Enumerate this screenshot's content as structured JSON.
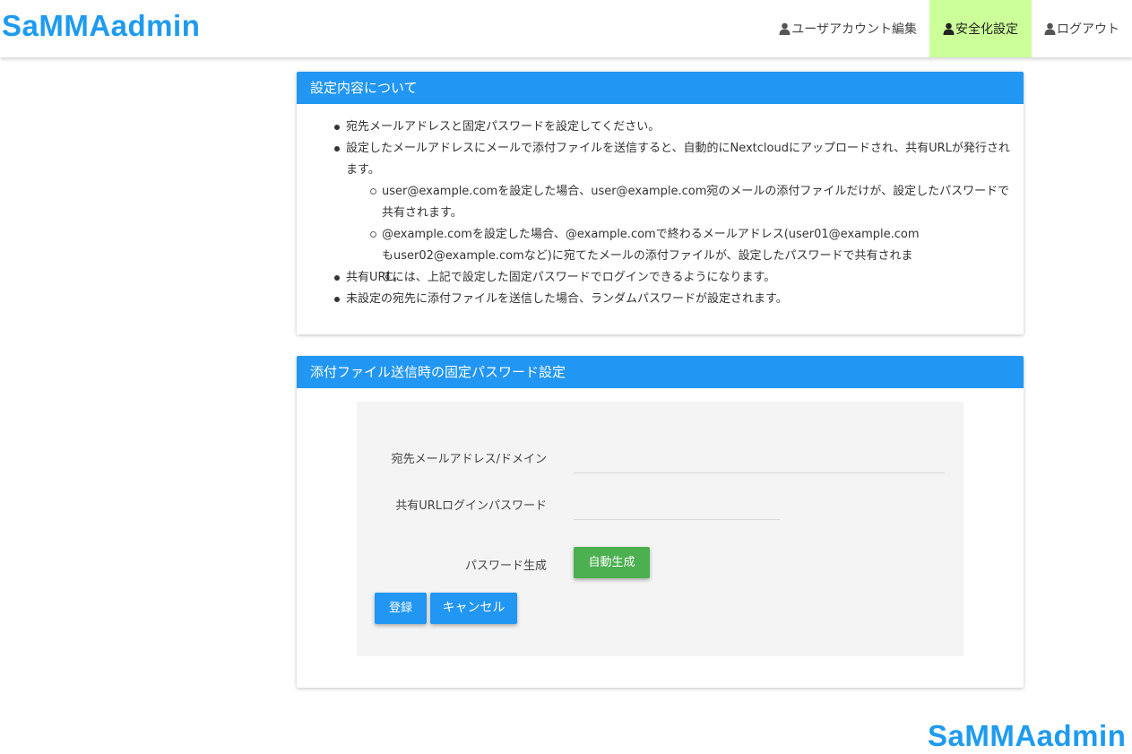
{
  "header": {
    "brand": "SaMMAadmin",
    "nav": [
      {
        "label": "ユーザアカウント編集",
        "icon": "user-icon"
      },
      {
        "label": "安全化設定",
        "icon": "user-icon",
        "active": true
      },
      {
        "label": "ログアウト",
        "icon": "user-icon"
      }
    ]
  },
  "info_card": {
    "title": "設定内容について",
    "items": [
      "宛先メールアドレスと固定パスワードを設定してください。",
      "設定したメールアドレスにメールで添付ファイルを送信すると、自動的にNextcloudにアップロードされ、共有URLが発行されます。",
      "user@example.comを設定した場合、user@example.com宛のメールの添付ファイルだけが、設定したパスワードで共有されます。",
      "@example.comを設定した場合、@example.comで終わるメールアドレス(user01@example.comもuser02@example.comなど)に宛てたメールの添付ファイルが、設定したパスワードで共有されます。",
      "共有URLには、上記で設定した固定パスワードでログインできるようになります。",
      "未設定の宛先に添付ファイルを送信した場合、ランダムパスワードが設定されます。"
    ]
  },
  "form_card": {
    "title": "添付ファイル送信時の固定パスワード設定",
    "address_label": "宛先メールアドレス/ドメイン",
    "address_value": "",
    "password_label": "共有URLログインパスワード",
    "password_value": "",
    "generate_label": "パスワード生成",
    "generate_button": "自動生成",
    "submit_button": "登録",
    "cancel_button": "キャンセル"
  },
  "footer": {
    "brand": "SaMMAadmin"
  },
  "colors": {
    "brand": "#1e9bf0",
    "header_bar": "#2196f3",
    "active_nav": "#ccff99",
    "green_button": "#4caf50"
  }
}
